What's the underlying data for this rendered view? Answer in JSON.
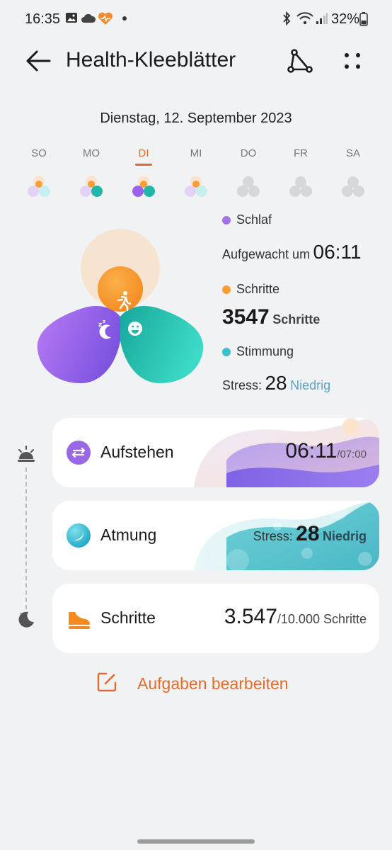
{
  "status_bar": {
    "time": "16:35",
    "battery": "32%"
  },
  "header": {
    "title": "Health-Kleeblätter"
  },
  "date": "Dienstag, 12. September 2023",
  "week": {
    "days": [
      {
        "label": "SO",
        "filled": true
      },
      {
        "label": "MO",
        "filled": true
      },
      {
        "label": "DI",
        "filled": true,
        "selected": true
      },
      {
        "label": "MI",
        "filled": true
      },
      {
        "label": "DO",
        "filled": false
      },
      {
        "label": "FR",
        "filled": false
      },
      {
        "label": "SA",
        "filled": false
      }
    ]
  },
  "summary": {
    "sleep": {
      "legend": "Schlaf",
      "prefix": "Aufgewacht um",
      "value": "06:11"
    },
    "steps": {
      "legend": "Schritte",
      "value": "3547",
      "unit": "Schritte"
    },
    "mood": {
      "legend": "Stimmung",
      "prefix": "Stress:",
      "value": "28",
      "level": "Niedrig"
    }
  },
  "cards": {
    "wake": {
      "title": "Aufstehen",
      "value": "06:11",
      "goal": "/07:00"
    },
    "breath": {
      "title": "Atmung",
      "prefix": "Stress:",
      "value": "28",
      "level": "Niedrig"
    },
    "steps": {
      "title": "Schritte",
      "value": "3.547",
      "goal": "/10.000 Schritte"
    }
  },
  "edit_label": "Aufgaben bearbeiten",
  "colors": {
    "accent": "#e36b2c",
    "sleep": "#a672e8",
    "steps": "#f99d35",
    "mood": "#3bbfc9",
    "level": "#5aa3c4"
  }
}
